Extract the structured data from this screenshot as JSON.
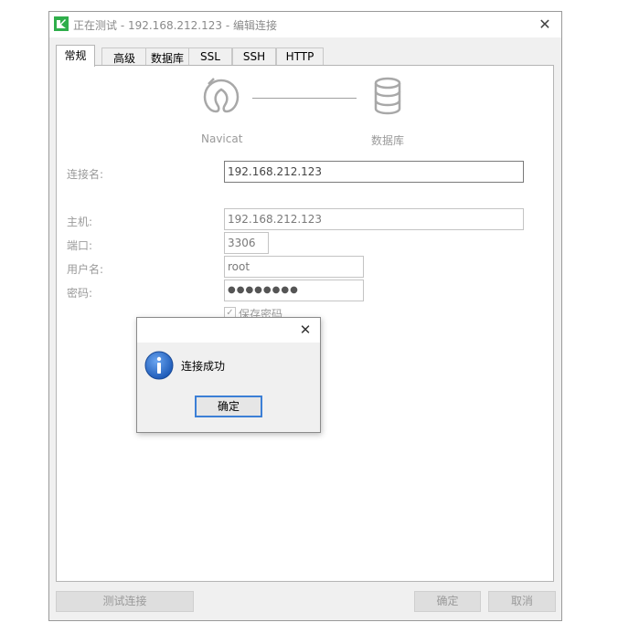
{
  "window": {
    "title": "正在测试 - 192.168.212.123 - 编辑连接",
    "close_glyph": "✕"
  },
  "tabs": [
    {
      "label": "常规",
      "active": true
    },
    {
      "label": "高级",
      "active": false
    },
    {
      "label": "数据库",
      "active": false
    },
    {
      "label": "SSL",
      "active": false
    },
    {
      "label": "SSH",
      "active": false
    },
    {
      "label": "HTTP",
      "active": false
    }
  ],
  "flow": {
    "left_label": "Navicat",
    "right_label": "数据库",
    "left_icon": "navicat-logo-icon",
    "right_icon": "database-icon"
  },
  "form": {
    "connection_name_label": "连接名:",
    "connection_name_value": "192.168.212.123",
    "host_label": "主机:",
    "host_value": "192.168.212.123",
    "port_label": "端口:",
    "port_value": "3306",
    "user_label": "用户名:",
    "user_value": "root",
    "password_label": "密码:",
    "password_value": "●●●●●●●●",
    "save_password_label": "保存密码",
    "save_password_checked": true
  },
  "footer": {
    "test_button": "测试连接",
    "ok_button": "确定",
    "cancel_button": "取消"
  },
  "dialog": {
    "message": "连接成功",
    "ok_button": "确定",
    "close_glyph": "✕",
    "icon": "info-icon"
  },
  "colors": {
    "accent": "#3c7fd6",
    "info_blue": "#1e5bb8",
    "logo_green": "#2fae4b"
  }
}
